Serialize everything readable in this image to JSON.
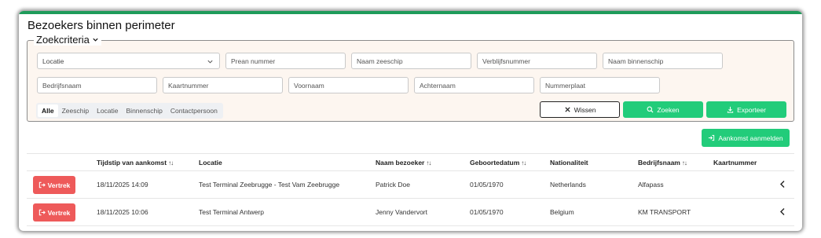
{
  "page": {
    "title": "Bezoekers binnen perimeter"
  },
  "criteria": {
    "legend": "Zoekcriteria",
    "fields": {
      "locatie": "Locatie",
      "prean": "Prean nummer",
      "zeeschip": "Naam zeeschip",
      "verblijf": "Verblijfsnummer",
      "binnenschip": "Naam binnenschip",
      "bedrijf": "Bedrijfsnaam",
      "kaart": "Kaartnummer",
      "voornaam": "Voornaam",
      "achternaam": "Achternaam",
      "nummerplaat": "Nummerplaat"
    },
    "segments": [
      "Alle",
      "Zeeschip",
      "Locatie",
      "Binnenschip",
      "Contactpersoon"
    ],
    "active_segment": "Alle",
    "buttons": {
      "clear": "Wissen",
      "search": "Zoeken",
      "export": "Exporteer"
    }
  },
  "actions": {
    "register_arrival": "Aankomst aanmelden"
  },
  "table": {
    "columns": [
      "Tijdstip van aankomst",
      "Locatie",
      "Naam bezoeker",
      "Geboortedatum",
      "Nationaliteit",
      "Bedrijfsnaam",
      "Kaartnummer"
    ],
    "depart_label": "Vertrek",
    "rows": [
      {
        "arrival": "18/11/2025 14:09",
        "location": "Test Terminal Zeebrugge - Test Vam Zeebrugge",
        "name": "Patrick Doe",
        "birthdate": "01/05/1970",
        "nationality": "Netherlands",
        "company": "Alfapass",
        "card": ""
      },
      {
        "arrival": "18/11/2025 10:06",
        "location": "Test Terminal Antwerp",
        "name": "Jenny Vandervort",
        "birthdate": "01/05/1970",
        "nationality": "Belgium",
        "company": "KM TRANSPORT",
        "card": ""
      }
    ]
  },
  "colors": {
    "accent_green": "#22cc7a",
    "frame_green": "#1e9b5a",
    "danger": "#ee5a5a",
    "criteria_bg": "#fdf6f0"
  },
  "icons": [
    "chevron-down-icon",
    "close-icon",
    "search-icon",
    "download-icon",
    "login-icon",
    "logout-icon",
    "sort-icon",
    "chevron-left-icon"
  ]
}
